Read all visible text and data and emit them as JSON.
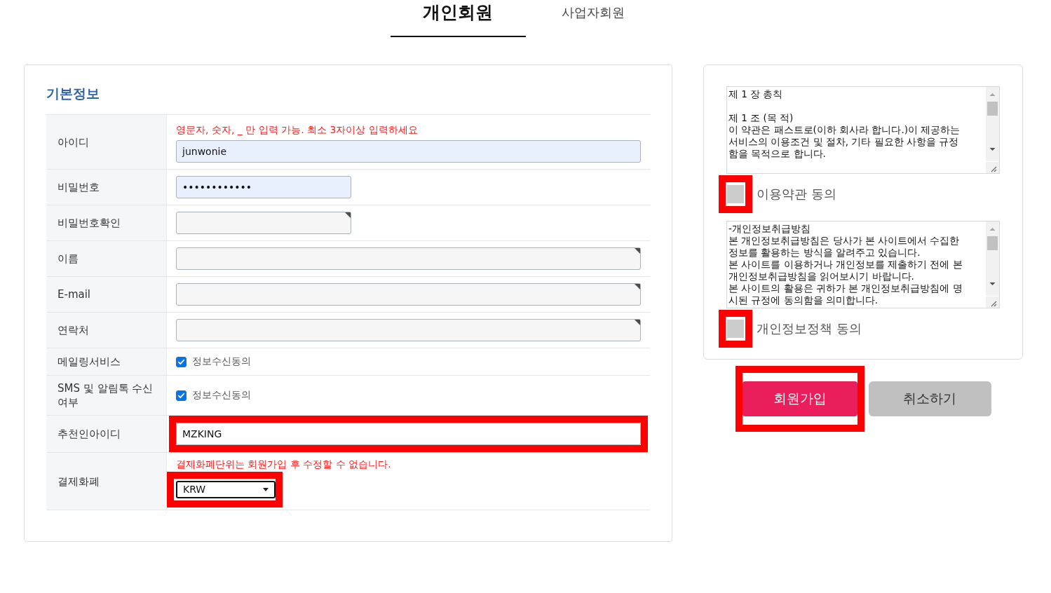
{
  "tabs": [
    {
      "label": "개인회원",
      "selected": true
    },
    {
      "label": "사업자회원",
      "selected": false
    }
  ],
  "basic_info": {
    "title": "기본정보",
    "fields": [
      {
        "kind": "text",
        "label": "아이디",
        "note": "영문자, 숫자, _ 만 입력 가능. 최소 3자이상 입력하세요",
        "value": "junwonie",
        "autofilled": true,
        "corner_mark": false,
        "highlighted": false
      },
      {
        "kind": "password",
        "label": "비밀번호",
        "value": "••••••••••••",
        "autofilled": true,
        "corner_mark": false,
        "highlighted": false
      },
      {
        "kind": "password",
        "label": "비밀번호확인",
        "autofilled": false,
        "corner_mark": true,
        "highlighted": false
      },
      {
        "kind": "text",
        "label": "이름",
        "autofilled": false,
        "corner_mark": true,
        "highlighted": false
      },
      {
        "kind": "text",
        "label": "E-mail",
        "autofilled": false,
        "corner_mark": true,
        "highlighted": false
      },
      {
        "kind": "text",
        "label": "연락처",
        "autofilled": false,
        "corner_mark": true,
        "highlighted": false
      },
      {
        "kind": "checkbox",
        "label": "메일링서비스",
        "option": "정보수신동의",
        "checked": true,
        "highlighted": false
      },
      {
        "kind": "checkbox",
        "label": "SMS 및 알림톡 수신 여부",
        "option": "정보수신동의",
        "checked": true,
        "highlighted": false
      },
      {
        "kind": "text",
        "label": "추천인아이디",
        "value": "MZKING",
        "autofilled": false,
        "corner_mark": false,
        "highlighted": true
      },
      {
        "kind": "select",
        "label": "결제화폐",
        "note": "결제화폐단위는 회원가입 후 수정할 수 없습니다.",
        "value": "KRW",
        "focused": true,
        "highlighted": true
      }
    ]
  },
  "agreements": [
    {
      "text": "제 1 장 총칙\n\n제 1 조 (목 적)\n이 약관은 패스트로(이하 회사라 합니다.)이 제공하는\n서비스의 이용조건 및 절차, 기타 필요한 사항을 규정\n함을 목적으로 합니다.",
      "label": "이용약관 동의",
      "checked": false,
      "highlighted": true
    },
    {
      "text": "-개인정보취급방침\n본 개인정보취급방침은 당사가 본 사이트에서 수집한\n정보를 활용하는 방식을 알려주고 있습니다.\n본 사이트를 이용하거나 개인정보를 제출하기 전에 본\n개인정보취급방침을 읽어보시기 바랍니다.\n본 사이트의 활용은 귀하가 본 개인정보취급방침에 명\n시된 규정에 동의함을 의미합니다.",
      "label": "개인정보정책 동의",
      "checked": false,
      "highlighted": true
    }
  ],
  "buttons": [
    {
      "kind": "primary",
      "label": "회원가입",
      "highlighted": true
    },
    {
      "kind": "secondary",
      "label": "취소하기",
      "highlighted": false
    }
  ]
}
